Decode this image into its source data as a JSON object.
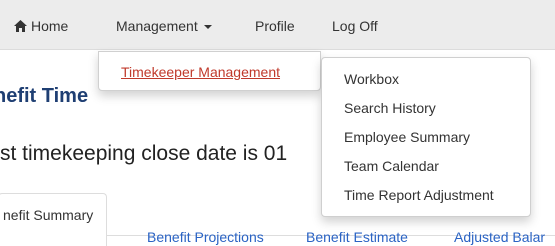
{
  "nav": {
    "home_label": "Home",
    "management_label": "Management",
    "profile_label": "Profile",
    "logoff_label": "Log Off"
  },
  "management_menu": {
    "items": [
      "Timekeeper Management"
    ]
  },
  "sub_menu": {
    "items": [
      "Workbox",
      "Search History",
      "Employee Summary",
      "Team Calendar",
      "Time Report Adjustment"
    ]
  },
  "page": {
    "title": "nefit Time",
    "close_date_text": "st timekeeping close date is 01"
  },
  "tabs": [
    {
      "label": "nefit Summary",
      "active": true
    },
    {
      "label": "Benefit Projections",
      "active": false
    },
    {
      "label": "Benefit Estimate",
      "active": false
    },
    {
      "label": "Adjusted Balar",
      "active": false
    }
  ],
  "colors": {
    "navbar_bg": "#ececec",
    "title": "#1f3f73",
    "link": "#2a63c4",
    "menu_link": "#c0392b"
  },
  "icons": {
    "home": "home-icon",
    "caret": "caret-down-icon"
  }
}
